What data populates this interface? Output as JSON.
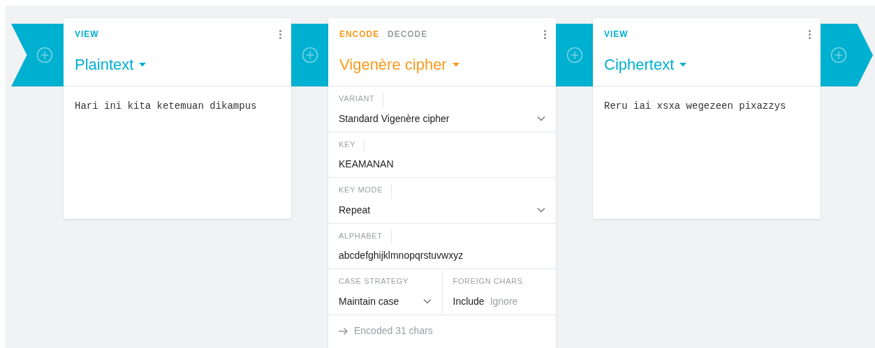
{
  "cards": [
    {
      "kind": "view",
      "tabs": [
        {
          "label": "VIEW",
          "selected": true
        }
      ],
      "title": "Plaintext",
      "content": "Hari ini kita ketemuan dikampus"
    },
    {
      "kind": "operation",
      "tabs": [
        {
          "label": "ENCODE",
          "selected": true
        },
        {
          "label": "DECODE",
          "selected": false
        }
      ],
      "title": "Vigenère cipher",
      "rows": [
        [
          {
            "kind": "select",
            "label": "VARIANT",
            "value": "Standard Vigenère cipher"
          }
        ],
        [
          {
            "kind": "text",
            "label": "KEY",
            "value": "KEAMANAN"
          }
        ],
        [
          {
            "kind": "select",
            "label": "KEY MODE",
            "value": "Repeat"
          }
        ],
        [
          {
            "kind": "text",
            "label": "ALPHABET",
            "value": "abcdefghijklmnopqrstuvwxyz"
          }
        ],
        [
          {
            "kind": "select",
            "label": "CASE STRATEGY",
            "value": "Maintain case"
          },
          {
            "kind": "options",
            "label": "FOREIGN CHARS",
            "options": [
              {
                "label": "Include",
                "selected": true
              },
              {
                "label": "Ignore",
                "selected": false
              }
            ]
          }
        ]
      ],
      "status": "Encoded 31 chars"
    },
    {
      "kind": "view",
      "tabs": [
        {
          "label": "VIEW",
          "selected": true
        }
      ],
      "title": "Ciphertext",
      "content": "Reru iai xsxa wegezeen pixazzys"
    }
  ]
}
